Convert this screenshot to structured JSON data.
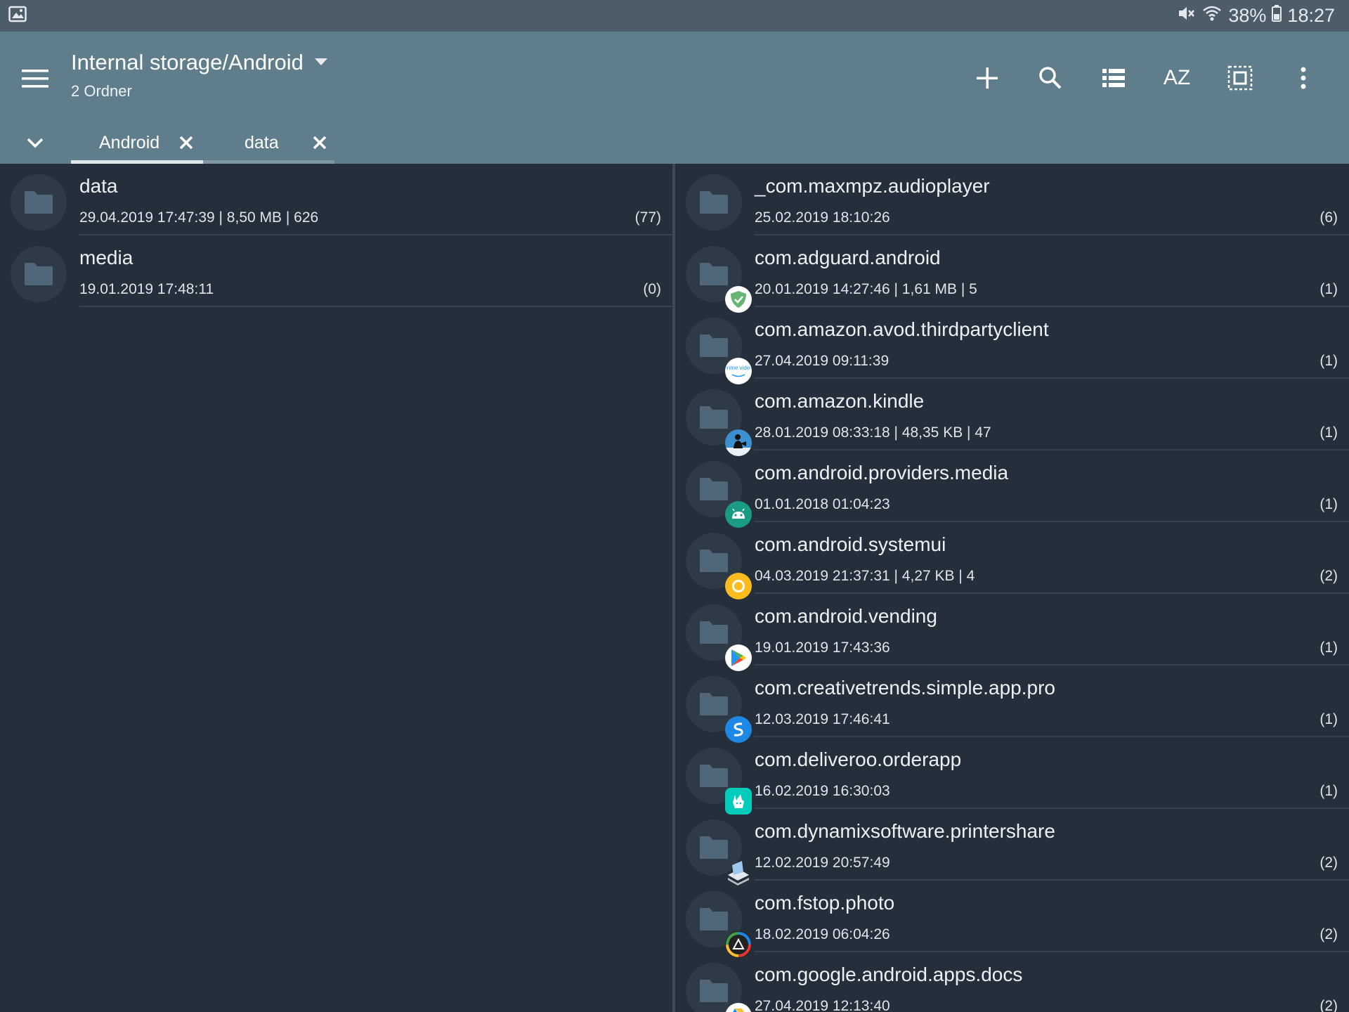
{
  "status_bar": {
    "battery": "38%",
    "time": "18:27",
    "icons": [
      "gallery-icon",
      "mute-icon",
      "wifi-icon",
      "battery-icon"
    ]
  },
  "app_bar": {
    "title": "Internal storage/Android",
    "subtitle": "2 Ordner",
    "sort_label": "AZ",
    "actions": [
      "add-icon",
      "search-icon",
      "list-view-icon",
      "sort-az",
      "select-all-icon",
      "more-options-icon"
    ]
  },
  "tabs": [
    {
      "label": "Android",
      "active": true
    },
    {
      "label": "data",
      "active": false
    }
  ],
  "colors": {
    "statusbar": "#4c5c69",
    "appbar": "#607d8b",
    "background": "#242f3b",
    "tab_active_underline": "#e0e5e8",
    "tab_inactive_underline": "#7f97a2"
  },
  "left_pane": {
    "items": [
      {
        "name": "data",
        "meta": "29.04.2019 17:47:39 | 8,50 MB | 626",
        "count": "(77)"
      },
      {
        "name": "media",
        "meta": "19.01.2019 17:48:11",
        "count": "(0)"
      }
    ]
  },
  "right_pane": {
    "items": [
      {
        "name": "_com.maxmpz.audioplayer",
        "meta": "25.02.2019 18:10:26",
        "count": "(6)",
        "badge": "none"
      },
      {
        "name": "com.adguard.android",
        "meta": "20.01.2019 14:27:46 | 1,61 MB | 5",
        "count": "(1)",
        "badge": "adguard-icon"
      },
      {
        "name": "com.amazon.avod.thirdpartyclient",
        "meta": "27.04.2019 09:11:39",
        "count": "(1)",
        "badge": "prime-video-icon",
        "badge_text": "prime video"
      },
      {
        "name": "com.amazon.kindle",
        "meta": "28.01.2019 08:33:18 | 48,35 KB | 47",
        "count": "(1)",
        "badge": "kindle-icon"
      },
      {
        "name": "com.android.providers.media",
        "meta": "01.01.2018 01:04:23",
        "count": "(1)",
        "badge": "android-icon"
      },
      {
        "name": "com.android.systemui",
        "meta": "04.03.2019 21:37:31 | 4,27 KB | 4",
        "count": "(2)",
        "badge": "systemui-icon"
      },
      {
        "name": "com.android.vending",
        "meta": "19.01.2019 17:43:36",
        "count": "(1)",
        "badge": "play-store-icon"
      },
      {
        "name": "com.creativetrends.simple.app.pro",
        "meta": "12.03.2019 17:46:41",
        "count": "(1)",
        "badge": "simple-app-icon"
      },
      {
        "name": "com.deliveroo.orderapp",
        "meta": "16.02.2019 16:30:03",
        "count": "(1)",
        "badge": "deliveroo-icon"
      },
      {
        "name": "com.dynamixsoftware.printershare",
        "meta": "12.02.2019 20:57:49",
        "count": "(2)",
        "badge": "printershare-icon"
      },
      {
        "name": "com.fstop.photo",
        "meta": "18.02.2019 06:04:26",
        "count": "(2)",
        "badge": "fstop-icon"
      },
      {
        "name": "com.google.android.apps.docs",
        "meta": "27.04.2019 12:13:40",
        "count": "(2)",
        "badge": "google-drive-icon"
      }
    ]
  }
}
